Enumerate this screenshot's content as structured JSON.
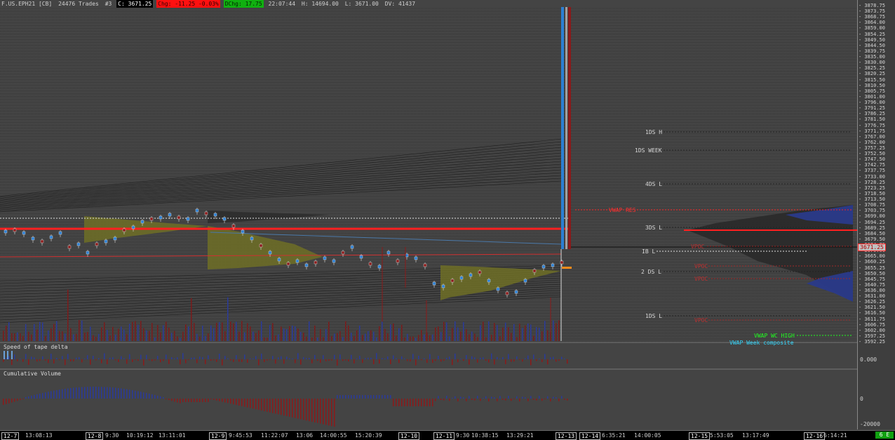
{
  "header": {
    "symbol": "F.US.EPH21 [CB]",
    "trades": "24476 Trades",
    "count": "#3",
    "close": "C: 3671.25",
    "change": "Chg: -11.25 -0.03%",
    "dchange": "DChg: 17.75",
    "time": "22:07:44",
    "high": "H: 14694.00",
    "low": "L: 3671.00",
    "volume": "DV: 41437"
  },
  "price_axis": {
    "ticks": [
      "3878.75",
      "3873.75",
      "3868.75",
      "3864.00",
      "3859.00",
      "3854.25",
      "3849.50",
      "3844.50",
      "3839.75",
      "3835.00",
      "3830.00",
      "3825.25",
      "3820.25",
      "3815.50",
      "3810.50",
      "3805.75",
      "3801.00",
      "3796.00",
      "3791.25",
      "3786.25",
      "3781.50",
      "3776.75",
      "3771.75",
      "3767.00",
      "3762.00",
      "3757.25",
      "3752.50",
      "3747.50",
      "3742.75",
      "3737.75",
      "3733.00",
      "3728.25",
      "3723.25",
      "3718.50",
      "3713.50",
      "3708.75",
      "3703.75",
      "3699.00",
      "3694.25",
      "3689.25",
      "3684.50",
      "3679.50",
      "3674.75",
      "3670.00",
      "3665.00",
      "3660.25",
      "3655.25",
      "3650.50",
      "3645.75",
      "3640.75",
      "3636.00",
      "3631.00",
      "3626.25",
      "3621.50",
      "3616.50",
      "3611.75",
      "3606.75",
      "3602.00",
      "3597.25",
      "3592.25"
    ],
    "current_price": "3671.25",
    "delta_zero": "0.000",
    "cum_zero": "0",
    "cum_low": "-20000"
  },
  "levels": {
    "ds1_high": "1DS H",
    "ds1_week": "1DS WEEK",
    "ds4_low": "4DS L",
    "vwap_res": "VWAP RES",
    "ds3_low": "3DS L",
    "vpoc1": "VPOC",
    "ib_low": "IB L",
    "vpoc2": "VPOC",
    "ds2_low": "2 DS L",
    "vpoc3": "VPOC",
    "ds1_low": "1DS L",
    "vpoc4": "VPOC",
    "vwap_wc_high": "VWAP WC HIGH",
    "vwap_week": "VWAP Week composite"
  },
  "panes": {
    "delta_title": "Speed of tape delta",
    "cum_title": "Cumulative Volume"
  },
  "time_axis": {
    "labels": [
      {
        "text": "12-7",
        "box": true
      },
      {
        "text": "13:08:13",
        "box": false
      },
      {
        "text": "12-8",
        "box": true
      },
      {
        "text": "9:30",
        "box": false
      },
      {
        "text": "10:19:12",
        "box": false
      },
      {
        "text": "13:11:01",
        "box": false
      },
      {
        "text": "12-9",
        "box": true
      },
      {
        "text": "9:45:53",
        "box": false
      },
      {
        "text": "11:22:07",
        "box": false
      },
      {
        "text": "13:06",
        "box": false
      },
      {
        "text": "14:00:55",
        "box": false
      },
      {
        "text": "15:20:39",
        "box": false
      },
      {
        "text": "12-10",
        "box": true
      },
      {
        "text": "12-11",
        "box": true
      },
      {
        "text": "9:30",
        "box": false
      },
      {
        "text": "10:38:15",
        "box": false
      },
      {
        "text": "13:29:21",
        "box": false
      },
      {
        "text": "12-13",
        "box": true
      },
      {
        "text": "12-14",
        "box": true
      },
      {
        "text": "6:35:21",
        "box": false
      },
      {
        "text": "14:00:05",
        "box": false
      },
      {
        "text": "12-15",
        "box": true
      },
      {
        "text": "5:53:05",
        "box": false
      },
      {
        "text": "13:17:49",
        "box": false
      },
      {
        "text": "12-16",
        "box": true
      },
      {
        "text": "6:14:21",
        "box": false
      }
    ],
    "zoom": "6 E"
  },
  "colors": {
    "background": "#444444",
    "up": "#2a7fd4",
    "down": "#8b1a1a",
    "vwap": "#ff2020",
    "profile_yellow": "#7d7d2a",
    "profile_blue": "#2a3a8a",
    "profile_gray": "#2a2a2a"
  }
}
